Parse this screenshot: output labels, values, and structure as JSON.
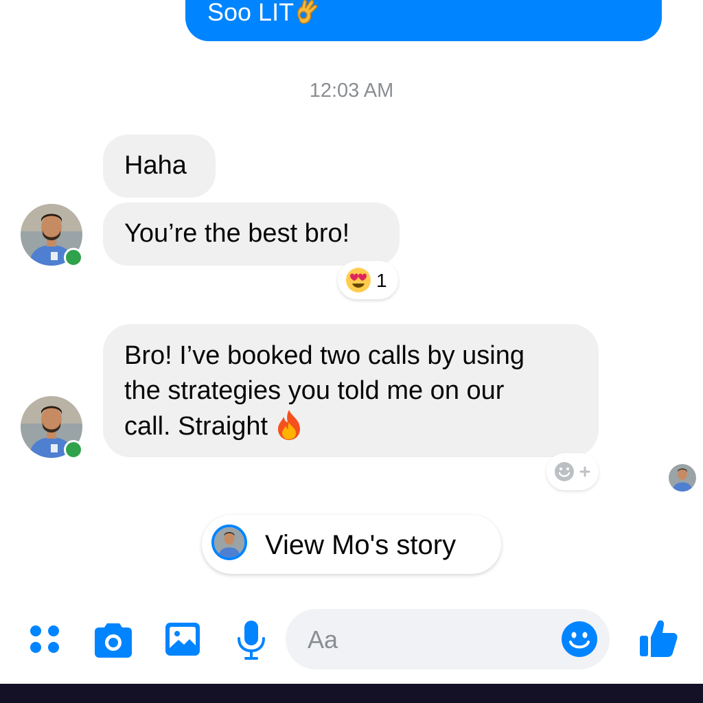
{
  "thread": {
    "outgoing": [
      {
        "text": "Soo LIT",
        "emoji": "ok-hand-emoji"
      }
    ],
    "timestamp": "12:03 AM",
    "incoming": [
      {
        "text": "Haha"
      },
      {
        "text": "You’re the best bro!",
        "reaction": {
          "emoji": "heart-eyes-emoji",
          "count": "1"
        }
      },
      {
        "lines": [
          "Bro! I’ve booked two calls by using",
          "the strategies you told me on our",
          "call. Straight"
        ],
        "emoji": "fire-emoji"
      }
    ],
    "add_reaction_icon": "add-reaction-icon",
    "seen_by": "contact-avatar"
  },
  "story": {
    "label": "View Mo's story"
  },
  "composer": {
    "placeholder": "Aa",
    "icons": [
      "grid-menu-icon",
      "camera-icon",
      "gallery-icon",
      "microphone-icon",
      "emoji-icon",
      "thumbs-up-icon"
    ]
  },
  "colors": {
    "accent": "#0084ff",
    "bubble_incoming": "#f0f0f0",
    "presence": "#31a24c",
    "timestamp": "#8a8d91",
    "bottom_strip": "#141026"
  }
}
